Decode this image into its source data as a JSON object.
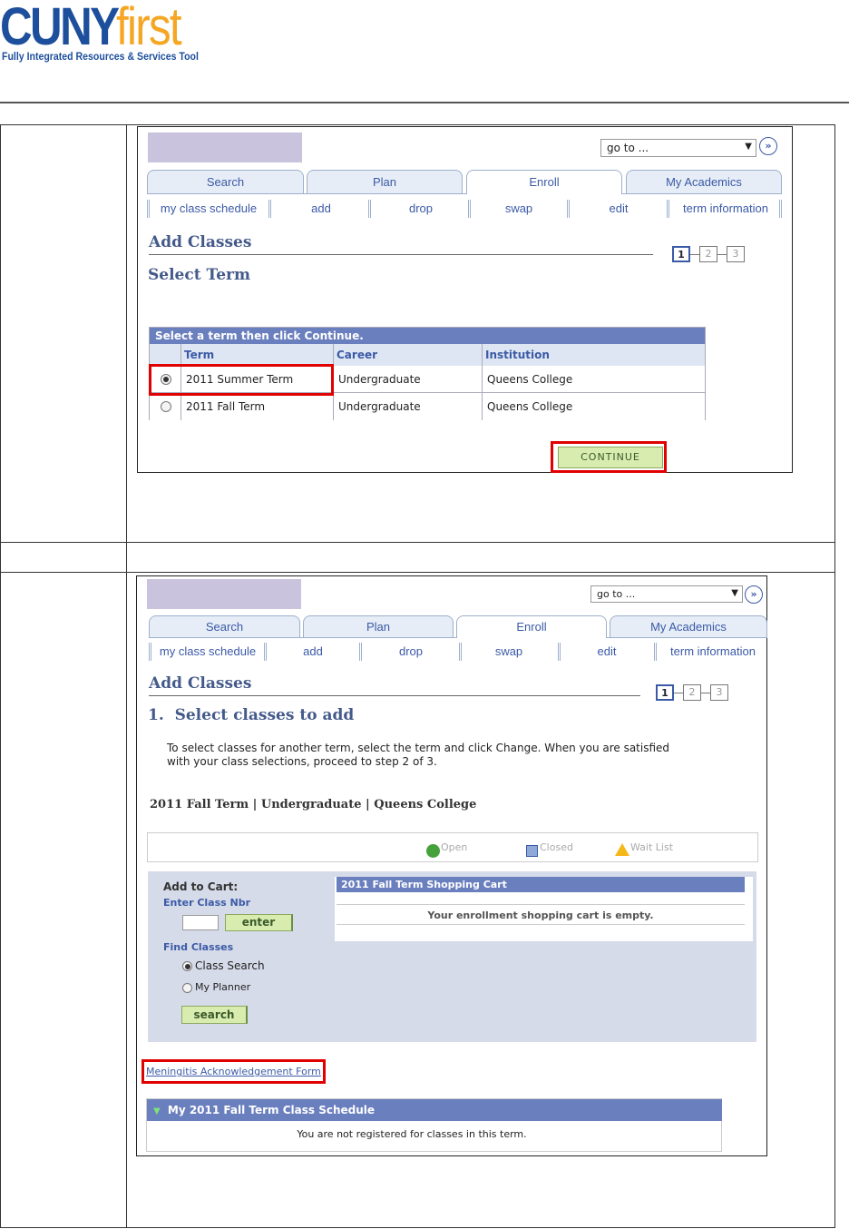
{
  "header": {
    "logo_cuny": "CUNY",
    "logo_first": "first",
    "tagline": "Fully Integrated Resources & Services Tool"
  },
  "colors": {
    "brand_blue": "#1d4f9c",
    "brand_orange": "#f5a623",
    "highlight_red": "#e00000",
    "grid_header": "#6a7fbe"
  },
  "nav": {
    "goto": "go to ...",
    "tabs": [
      "Search",
      "Plan",
      "Enroll",
      "My Academics"
    ],
    "subtabs": [
      "my class schedule",
      "add",
      "drop",
      "swap",
      "edit",
      "term information"
    ]
  },
  "step1": {
    "title": "Add Classes",
    "subtitle": "Select Term",
    "steps": [
      "1",
      "2",
      "3"
    ],
    "grid_title": "Select a term then click Continue.",
    "columns": [
      "Term",
      "Career",
      "Institution"
    ],
    "rows": [
      {
        "term": "2011 Summer Term",
        "career": "Undergraduate",
        "institution": "Queens College",
        "selected": true
      },
      {
        "term": "2011 Fall Term",
        "career": "Undergraduate",
        "institution": "Queens College",
        "selected": false
      }
    ],
    "continue_label": "CONTINUE"
  },
  "step2": {
    "title": "Add Classes",
    "subtitle": "1.  Select classes to add",
    "steps": [
      "1",
      "2",
      "3"
    ],
    "instructions": "To select classes for another term, select the term and click Change.  When you are satisfied with your class selections, proceed to step 2 of 3.",
    "term_line": "2011 Fall Term | Undergraduate | Queens College",
    "legend": [
      "Open",
      "Closed",
      "Wait List"
    ],
    "add_to_cart": "Add to Cart:",
    "enter_class_nbr": "Enter Class Nbr",
    "enter_btn": "enter",
    "find_classes": "Find Classes",
    "option_class_search": "Class Search",
    "option_my_planner": "My Planner",
    "search_btn": "search",
    "cart_title": "2011 Fall Term Shopping Cart",
    "cart_empty": "Your enrollment shopping cart is empty.",
    "meningitis_link": "Meningitis Acknowledgement Form",
    "schedule_title": "My 2011 Fall Term Class Schedule",
    "schedule_empty": "You are not registered for classes in this term."
  }
}
